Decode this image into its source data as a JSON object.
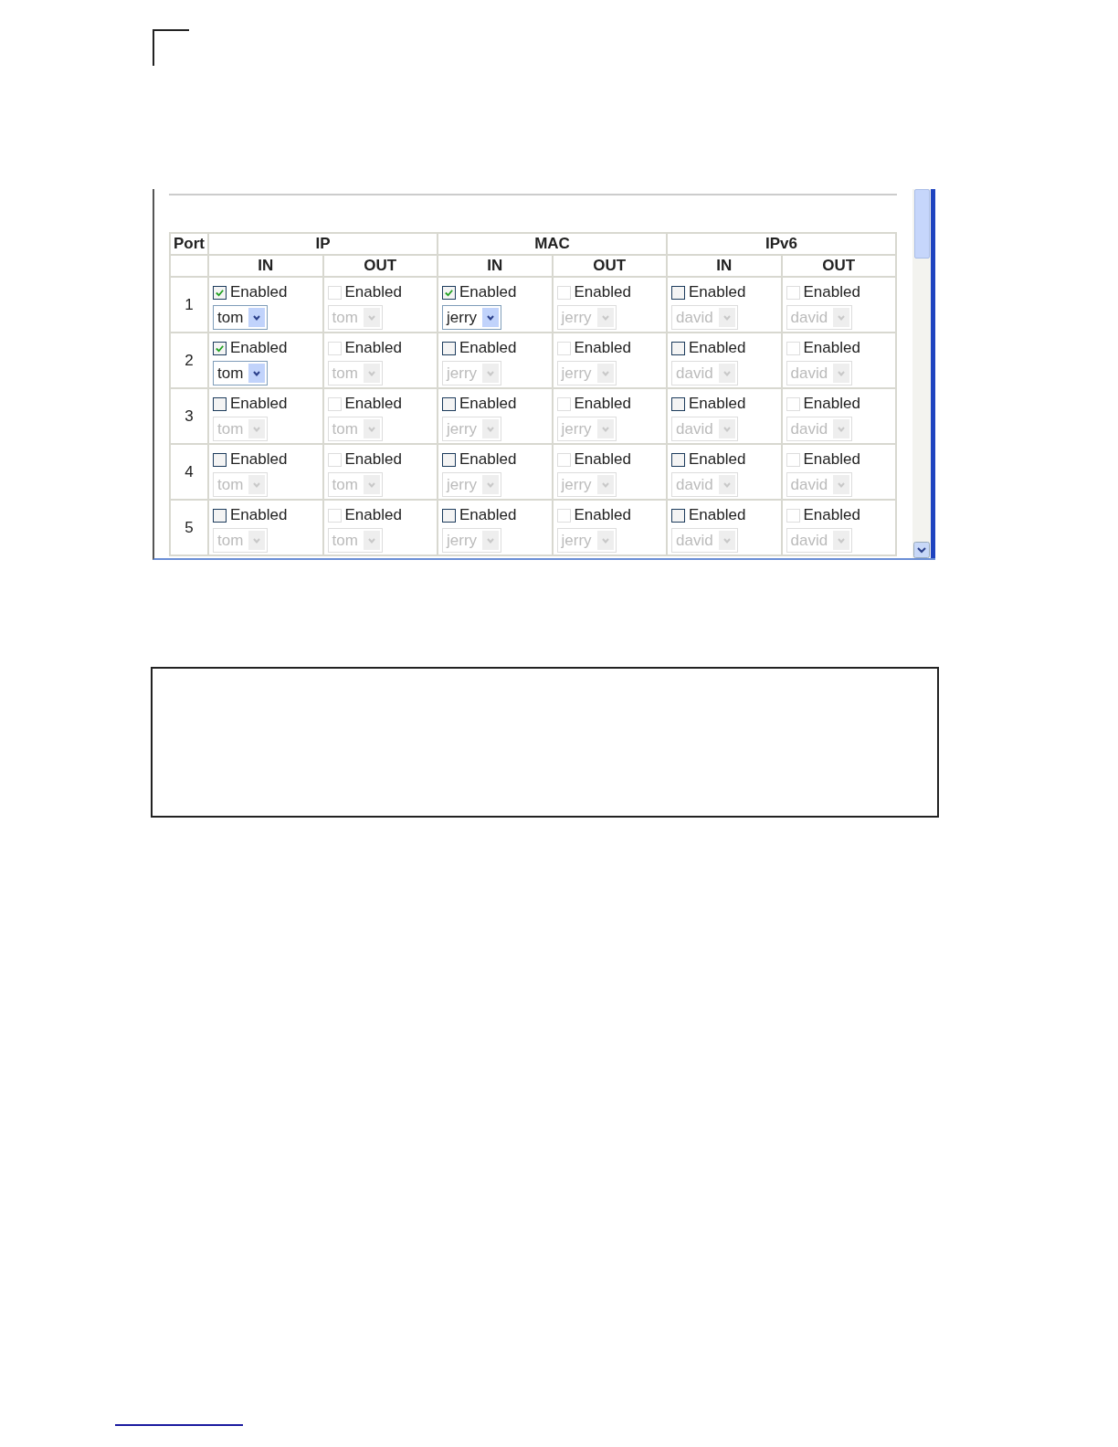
{
  "table": {
    "port_header": "Port",
    "groups": [
      "IP",
      "MAC",
      "IPv6"
    ],
    "subheaders": [
      "IN",
      "OUT",
      "IN",
      "OUT",
      "IN",
      "OUT"
    ],
    "rows": [
      {
        "port": "1",
        "cells": [
          {
            "label": "Enabled",
            "checked": true,
            "check_disabled": false,
            "value": "tom",
            "select_disabled": false
          },
          {
            "label": "Enabled",
            "checked": false,
            "check_disabled": true,
            "value": "tom",
            "select_disabled": true
          },
          {
            "label": "Enabled",
            "checked": true,
            "check_disabled": false,
            "value": "jerry",
            "select_disabled": false
          },
          {
            "label": "Enabled",
            "checked": false,
            "check_disabled": true,
            "value": "jerry",
            "select_disabled": true
          },
          {
            "label": "Enabled",
            "checked": false,
            "check_disabled": false,
            "value": "david",
            "select_disabled": true
          },
          {
            "label": "Enabled",
            "checked": false,
            "check_disabled": true,
            "value": "david",
            "select_disabled": true
          }
        ]
      },
      {
        "port": "2",
        "cells": [
          {
            "label": "Enabled",
            "checked": true,
            "check_disabled": false,
            "value": "tom",
            "select_disabled": false
          },
          {
            "label": "Enabled",
            "checked": false,
            "check_disabled": true,
            "value": "tom",
            "select_disabled": true
          },
          {
            "label": "Enabled",
            "checked": false,
            "check_disabled": false,
            "value": "jerry",
            "select_disabled": true
          },
          {
            "label": "Enabled",
            "checked": false,
            "check_disabled": true,
            "value": "jerry",
            "select_disabled": true
          },
          {
            "label": "Enabled",
            "checked": false,
            "check_disabled": false,
            "value": "david",
            "select_disabled": true
          },
          {
            "label": "Enabled",
            "checked": false,
            "check_disabled": true,
            "value": "david",
            "select_disabled": true
          }
        ]
      },
      {
        "port": "3",
        "cells": [
          {
            "label": "Enabled",
            "checked": false,
            "check_disabled": false,
            "value": "tom",
            "select_disabled": true
          },
          {
            "label": "Enabled",
            "checked": false,
            "check_disabled": true,
            "value": "tom",
            "select_disabled": true
          },
          {
            "label": "Enabled",
            "checked": false,
            "check_disabled": false,
            "value": "jerry",
            "select_disabled": true
          },
          {
            "label": "Enabled",
            "checked": false,
            "check_disabled": true,
            "value": "jerry",
            "select_disabled": true
          },
          {
            "label": "Enabled",
            "checked": false,
            "check_disabled": false,
            "value": "david",
            "select_disabled": true
          },
          {
            "label": "Enabled",
            "checked": false,
            "check_disabled": true,
            "value": "david",
            "select_disabled": true
          }
        ]
      },
      {
        "port": "4",
        "cells": [
          {
            "label": "Enabled",
            "checked": false,
            "check_disabled": false,
            "value": "tom",
            "select_disabled": true
          },
          {
            "label": "Enabled",
            "checked": false,
            "check_disabled": true,
            "value": "tom",
            "select_disabled": true
          },
          {
            "label": "Enabled",
            "checked": false,
            "check_disabled": false,
            "value": "jerry",
            "select_disabled": true
          },
          {
            "label": "Enabled",
            "checked": false,
            "check_disabled": true,
            "value": "jerry",
            "select_disabled": true
          },
          {
            "label": "Enabled",
            "checked": false,
            "check_disabled": false,
            "value": "david",
            "select_disabled": true
          },
          {
            "label": "Enabled",
            "checked": false,
            "check_disabled": true,
            "value": "david",
            "select_disabled": true
          }
        ]
      },
      {
        "port": "5",
        "cells": [
          {
            "label": "Enabled",
            "checked": false,
            "check_disabled": false,
            "value": "tom",
            "select_disabled": true
          },
          {
            "label": "Enabled",
            "checked": false,
            "check_disabled": true,
            "value": "tom",
            "select_disabled": true
          },
          {
            "label": "Enabled",
            "checked": false,
            "check_disabled": false,
            "value": "jerry",
            "select_disabled": true
          },
          {
            "label": "Enabled",
            "checked": false,
            "check_disabled": true,
            "value": "jerry",
            "select_disabled": true
          },
          {
            "label": "Enabled",
            "checked": false,
            "check_disabled": false,
            "value": "david",
            "select_disabled": true
          },
          {
            "label": "Enabled",
            "checked": false,
            "check_disabled": true,
            "value": "david",
            "select_disabled": true
          }
        ]
      }
    ]
  }
}
